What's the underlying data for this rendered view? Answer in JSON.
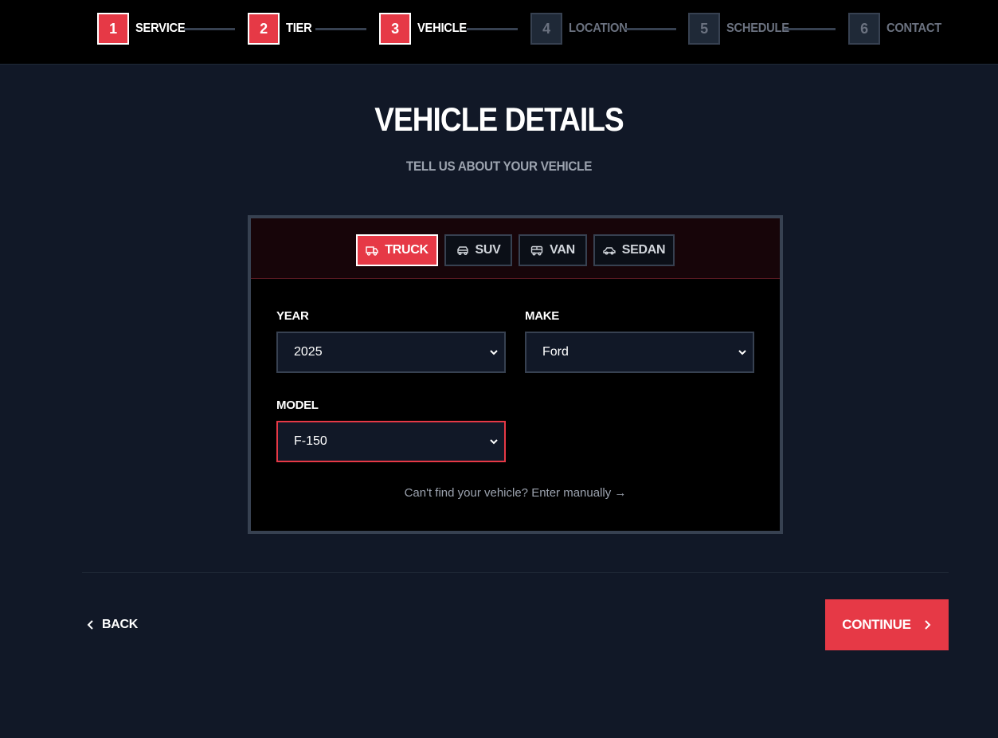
{
  "stepper": {
    "steps": [
      {
        "num": "1",
        "label": "SERVICE"
      },
      {
        "num": "2",
        "label": "TIER"
      },
      {
        "num": "3",
        "label": "VEHICLE"
      },
      {
        "num": "4",
        "label": "LOCATION"
      },
      {
        "num": "5",
        "label": "SCHEDULE"
      },
      {
        "num": "6",
        "label": "CONTACT"
      }
    ],
    "completed_through": 3
  },
  "header": {
    "title": "VEHICLE DETAILS",
    "subtitle": "TELL US ABOUT YOUR VEHICLE"
  },
  "vehicle_types": {
    "options": [
      {
        "label": "TRUCK",
        "icon": "truck-icon"
      },
      {
        "label": "SUV",
        "icon": "suv-icon"
      },
      {
        "label": "VAN",
        "icon": "van-icon"
      },
      {
        "label": "SEDAN",
        "icon": "sedan-icon"
      }
    ],
    "selected": "TRUCK"
  },
  "form": {
    "year": {
      "label": "YEAR",
      "value": "2025"
    },
    "make": {
      "label": "MAKE",
      "value": "Ford"
    },
    "model": {
      "label": "MODEL",
      "value": "F-150"
    },
    "manual_link": "Can't find your vehicle? Enter manually →"
  },
  "nav": {
    "back_label": "BACK",
    "continue_label": "CONTINUE"
  },
  "colors": {
    "accent": "#e63946",
    "background": "#111827",
    "header_bg": "#000000",
    "muted": "#6b7280"
  }
}
